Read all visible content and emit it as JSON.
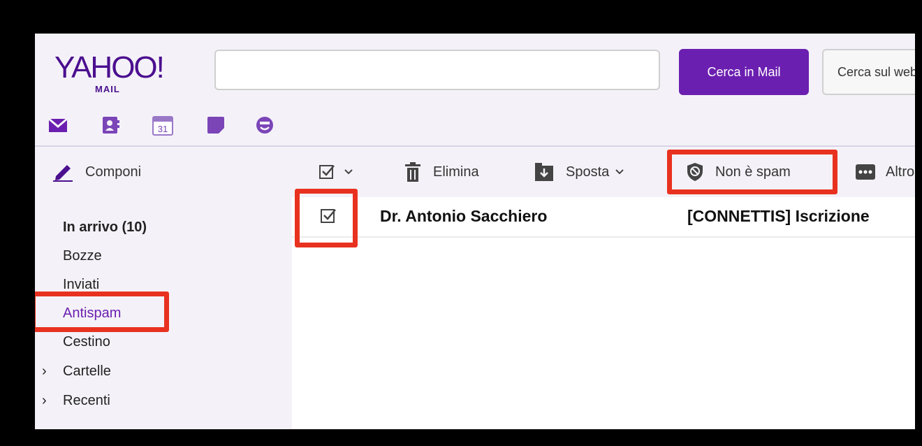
{
  "header": {
    "logo_text": "YAHOO!",
    "logo_sub": "MAIL",
    "search_placeholder": "",
    "search_mail_label": "Cerca in Mail",
    "search_web_label": "Cerca sul web",
    "calendar_day": "31",
    "nav_icons": [
      "mail-icon",
      "contacts-icon",
      "calendar-icon",
      "notepad-icon",
      "messenger-icon"
    ]
  },
  "toolbar": {
    "compose_label": "Componi",
    "delete_label": "Elimina",
    "move_label": "Sposta",
    "not_spam_label": "Non è spam",
    "more_label": "Altro"
  },
  "sidebar": {
    "folders": [
      {
        "label": "In arrivo (10)"
      },
      {
        "label": "Bozze"
      },
      {
        "label": "Inviati"
      },
      {
        "label": "Antispam"
      },
      {
        "label": "Cestino"
      },
      {
        "label": "Cartelle"
      },
      {
        "label": "Recenti"
      }
    ]
  },
  "list": {
    "rows": [
      {
        "sender": "Dr. Antonio Sacchiero",
        "subject": "[CONNETTIS] Iscrizione",
        "checked": true
      }
    ]
  },
  "colors": {
    "brand": "#6b1fb0",
    "logo": "#4b0f8f",
    "highlight": "#e8321f",
    "panel": "#f4f2f8"
  }
}
